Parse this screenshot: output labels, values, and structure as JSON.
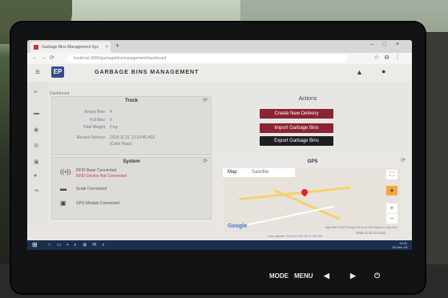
{
  "browser": {
    "tab_title": "Garbage Bins Management Sys",
    "url": "localhost:3000/garbagebinsmanagement/dashboard",
    "new_tab": "+"
  },
  "app": {
    "title": "GARBAGE BINS MANAGEMENT",
    "logo_text": "EP",
    "logo_sub": "Dashboard"
  },
  "truck": {
    "header": "Truck",
    "rows": [
      {
        "label": "Empty Bins",
        "value": "4"
      },
      {
        "label": "Full Bins",
        "value": "0"
      },
      {
        "label": "Total Weight",
        "value": "0 kg"
      },
      {
        "label": "Recent Delivery",
        "value": "2018-11-21 12:33:45.453"
      },
      {
        "label": "",
        "value": "(Celia Haas)"
      }
    ]
  },
  "system": {
    "header": "System",
    "items": [
      {
        "text": "RFID Base Connected",
        "status": "ok"
      },
      {
        "text": "RFID Device Not Connected",
        "status": "error"
      },
      {
        "text": "Scale Connected",
        "status": "ok"
      },
      {
        "text": "GPS Module Connected",
        "status": "ok"
      }
    ]
  },
  "actions": {
    "title": "Actions",
    "buttons": [
      "Create New Delivery",
      "Import Garbage Bins",
      "Export Garbage Bins"
    ]
  },
  "gps": {
    "title": "GPS",
    "map_tab": "Map",
    "satellite_tab": "Satellite",
    "google": "Google",
    "map_footer": "Map data ©2018 Google   Terms of Use   Report a map error",
    "last_update": "Last update:  2018-12-20 10:21:32.000",
    "zoom_in": "+",
    "zoom_out": "−"
  },
  "taskbar": {
    "time": "12:11",
    "date": "20-Dec-18"
  },
  "window_date": "2018-12-20 12:11:40",
  "device": {
    "mode": "MODE",
    "menu": "MENU"
  },
  "colors": {
    "button_red": "#8b2332",
    "button_dark": "#1f1f22",
    "error_text": "#c23b3b",
    "taskbar": "#1b2f4d"
  }
}
